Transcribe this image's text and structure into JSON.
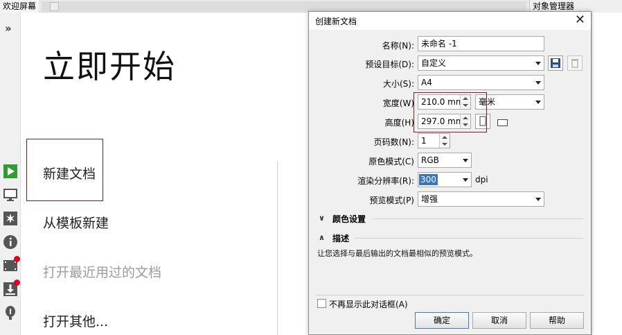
{
  "tabs": {
    "welcome": "欢迎屏幕",
    "object_manager": "对象管理器"
  },
  "left_rail": {
    "expand": "»",
    "icons": [
      "play-icon",
      "monitor-icon",
      "sparkle-icon",
      "info-icon",
      "film-icon",
      "download-icon",
      "balloon-icon"
    ]
  },
  "welcome": {
    "title": "立即开始",
    "items": {
      "new_doc": "新建文档",
      "from_template": "从模板新建",
      "open_recent": "打开最近用过的文档",
      "open_other": "打开其他..."
    }
  },
  "dialog": {
    "title": "创建新文档",
    "close": "✕",
    "name_label": "名称(N):",
    "name_value": "未命名 -1",
    "preset_label": "预设目标(D):",
    "preset_value": "自定义",
    "size_label": "大小(S):",
    "size_value": "A4",
    "width_label": "宽度(W)",
    "width_value": "210.0 mm",
    "height_label": "高度(H)",
    "height_value": "297.0 mm",
    "unit_value": "毫米",
    "pages_label": "页码数(N):",
    "pages_value": "1",
    "color_mode_label": "原色模式(C)",
    "color_mode_value": "RGB",
    "resolution_label": "渲染分辨率(R):",
    "resolution_value": "300",
    "resolution_unit": "dpi",
    "preview_label": "预览模式(P)",
    "preview_value": "增强",
    "color_settings": "颜色设置",
    "description_head": "描述",
    "description_text": "让您选择与最后输出的文档最相似的预览模式。",
    "dont_show": "不再显示此对话框(A)",
    "ok": "确定",
    "cancel": "取消",
    "help": "帮助"
  },
  "colors": {
    "accent": "#2f9e2f",
    "badge": "#e3001b",
    "highlight_border": "#8b1a1a",
    "selection": "#3a75c4"
  }
}
